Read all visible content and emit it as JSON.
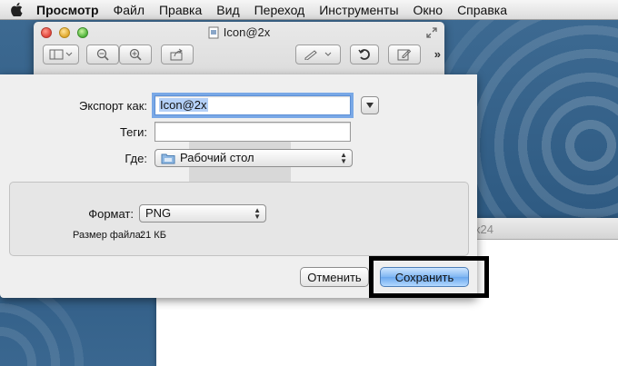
{
  "menubar": {
    "apple_icon": "apple-logo-icon",
    "app_name": "Просмотр",
    "items": [
      "Файл",
      "Правка",
      "Вид",
      "Переход",
      "Инструменты",
      "Окно",
      "Справка"
    ]
  },
  "window": {
    "title": "Icon@2x",
    "toolbar_icons": [
      "sidebar-toggle-icon",
      "zoom-out-icon",
      "zoom-in-icon",
      "share-icon",
      "annotate-icon",
      "rotate-icon",
      "edit-icon"
    ],
    "more_label": "»"
  },
  "back_window": {
    "title_fragment": "x24"
  },
  "dialog": {
    "export_as_label": "Экспорт как:",
    "export_as_value": "Icon@2x",
    "tags_label": "Теги:",
    "tags_value": "",
    "where_label": "Где:",
    "where_value": "Рабочий стол",
    "format_label": "Формат:",
    "format_value": "PNG",
    "file_size_label": "Размер файла:",
    "file_size_value": "21 КБ",
    "cancel_label": "Отменить",
    "save_label": "Сохранить"
  },
  "colors": {
    "desktop_blue": "#2f5d86",
    "default_button_blue": "#6aa7ee",
    "focus_ring": "#79a8e6",
    "highlight_border": "#000000"
  }
}
